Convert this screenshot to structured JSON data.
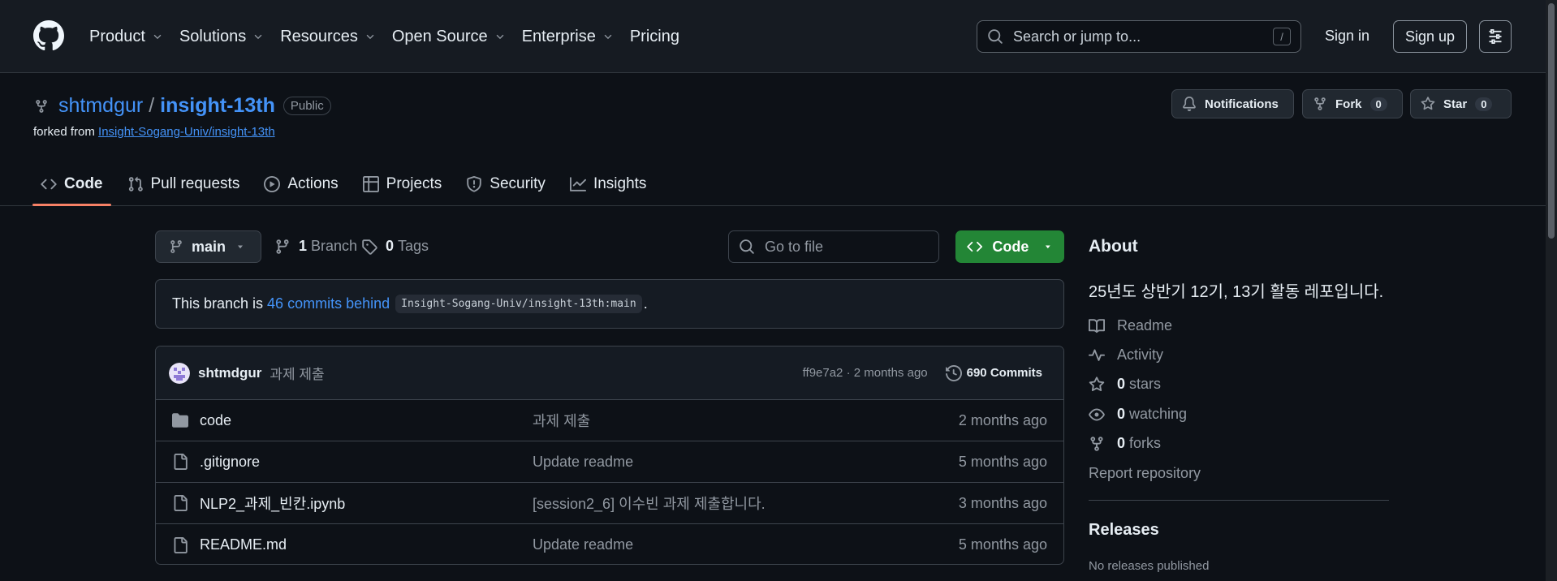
{
  "topbar": {
    "nav": [
      {
        "label": "Product",
        "dropdown": true
      },
      {
        "label": "Solutions",
        "dropdown": true
      },
      {
        "label": "Resources",
        "dropdown": true
      },
      {
        "label": "Open Source",
        "dropdown": true
      },
      {
        "label": "Enterprise",
        "dropdown": true
      },
      {
        "label": "Pricing",
        "dropdown": false
      }
    ],
    "search_placeholder": "Search or jump to...",
    "search_shortcut": "/",
    "sign_in": "Sign in",
    "sign_up": "Sign up"
  },
  "repo": {
    "owner": "shtmdgur",
    "separator": "/",
    "name": "insight-13th",
    "visibility": "Public",
    "forked_prefix": "forked from",
    "forked_source": "Insight-Sogang-Univ/insight-13th",
    "notifications_label": "Notifications",
    "fork_label": "Fork",
    "fork_count": "0",
    "star_label": "Star",
    "star_count": "0"
  },
  "tabs": [
    {
      "label": "Code",
      "icon": "code-icon",
      "active": true
    },
    {
      "label": "Pull requests",
      "icon": "pull-request-icon",
      "active": false
    },
    {
      "label": "Actions",
      "icon": "play-icon",
      "active": false
    },
    {
      "label": "Projects",
      "icon": "table-icon",
      "active": false
    },
    {
      "label": "Security",
      "icon": "shield-icon",
      "active": false
    },
    {
      "label": "Insights",
      "icon": "graph-icon",
      "active": false
    }
  ],
  "toolbar": {
    "branch": "main",
    "branch_count": "1",
    "branch_label": "Branch",
    "tag_count": "0",
    "tag_label": "Tags",
    "goto_placeholder": "Go to file",
    "code_button": "Code"
  },
  "behind": {
    "prefix": "This branch is",
    "link": "46 commits behind",
    "ref": "Insight-Sogang-Univ/insight-13th:main",
    "suffix": "."
  },
  "commit": {
    "author": "shtmdgur",
    "message": "과제 제출",
    "hash_time": "ff9e7a2 · 2 months ago",
    "commits_label": "690 Commits"
  },
  "files": [
    {
      "type": "folder",
      "name": "code",
      "message": "과제 제출",
      "age": "2 months ago"
    },
    {
      "type": "file",
      "name": ".gitignore",
      "message": "Update readme",
      "age": "5 months ago"
    },
    {
      "type": "file",
      "name": "NLP2_과제_빈칸.ipynb",
      "message": "[session2_6] 이수빈 과제 제출합니다.",
      "age": "3 months ago"
    },
    {
      "type": "file",
      "name": "README.md",
      "message": "Update readme",
      "age": "5 months ago"
    }
  ],
  "about": {
    "title": "About",
    "description": "25년도 상반기 12기, 13기 활동 레포입니다.",
    "readme": "Readme",
    "activity": "Activity",
    "stars_count": "0",
    "stars_label": "stars",
    "watching_count": "0",
    "watching_label": "watching",
    "forks_count": "0",
    "forks_label": "forks",
    "report": "Report repository"
  },
  "releases": {
    "title": "Releases",
    "empty": "No releases published"
  },
  "colors": {
    "link": "#4493f8",
    "primary_button": "#238636",
    "active_tab_underline": "#f78166",
    "background": "#0d1117"
  }
}
